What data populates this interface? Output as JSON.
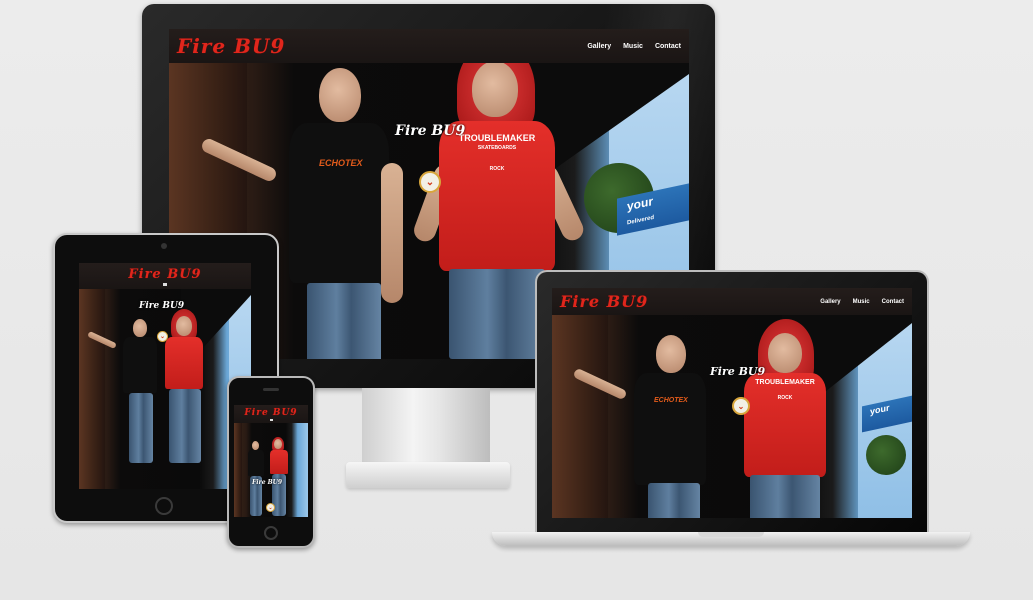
{
  "site": {
    "logo": "Fire BU9",
    "overlay_logo": "Fire BU9",
    "nav": [
      "Gallery",
      "Music",
      "Contact"
    ],
    "scroll_icon": "chevron-down-icon",
    "shirt_left": "ECHOTEX",
    "shirt_right_top": "TROUBLEMAKER",
    "shirt_right_mid": "SKATEBOARDS",
    "shirt_right_bottom": "ROCK",
    "billboard": "your",
    "billboard_sub": "Delivered"
  },
  "colors": {
    "background": "#e8e8e8",
    "brand_red": "#e0261c",
    "nav_bg": "#1f1917",
    "device_frame": "#111111"
  },
  "devices": [
    "desktop-monitor",
    "tablet",
    "smartphone",
    "laptop"
  ]
}
